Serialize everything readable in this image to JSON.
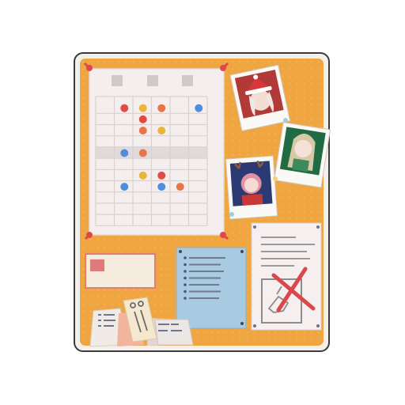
{
  "icon": "corkboard-icon",
  "colors": {
    "cork": "#efa540",
    "paper": "#f4efee",
    "pin": "#e0474c",
    "dot_red": "#e24b45",
    "dot_yellow": "#e9b53a",
    "dot_orange": "#e8744a",
    "dot_blue": "#4d8ee0",
    "memo_blue": "#a9cbe2"
  },
  "calendar": {
    "columns": 6,
    "rows": 11,
    "highlight_row": 4,
    "dots": [
      {
        "row": 0,
        "col": 1,
        "color": "red"
      },
      {
        "row": 0,
        "col": 2,
        "color": "yellow"
      },
      {
        "row": 0,
        "col": 3,
        "color": "orange"
      },
      {
        "row": 0,
        "col": 5,
        "color": "blue"
      },
      {
        "row": 1,
        "col": 2,
        "color": "red"
      },
      {
        "row": 2,
        "col": 2,
        "color": "orange"
      },
      {
        "row": 2,
        "col": 3,
        "color": "yellow"
      },
      {
        "row": 4,
        "col": 1,
        "color": "blue"
      },
      {
        "row": 4,
        "col": 2,
        "color": "orange"
      },
      {
        "row": 6,
        "col": 2,
        "color": "yellow"
      },
      {
        "row": 6,
        "col": 3,
        "color": "red"
      },
      {
        "row": 7,
        "col": 1,
        "color": "blue"
      },
      {
        "row": 7,
        "col": 3,
        "color": "blue"
      },
      {
        "row": 7,
        "col": 4,
        "color": "orange"
      }
    ]
  },
  "photos": [
    {
      "name": "photo-santa-girl",
      "subject": "girl-with-santa-hat-icon"
    },
    {
      "name": "photo-green-girl",
      "subject": "girl-in-green-icon"
    },
    {
      "name": "photo-reindeer-girl",
      "subject": "girl-with-reindeer-antlers-icon"
    }
  ]
}
